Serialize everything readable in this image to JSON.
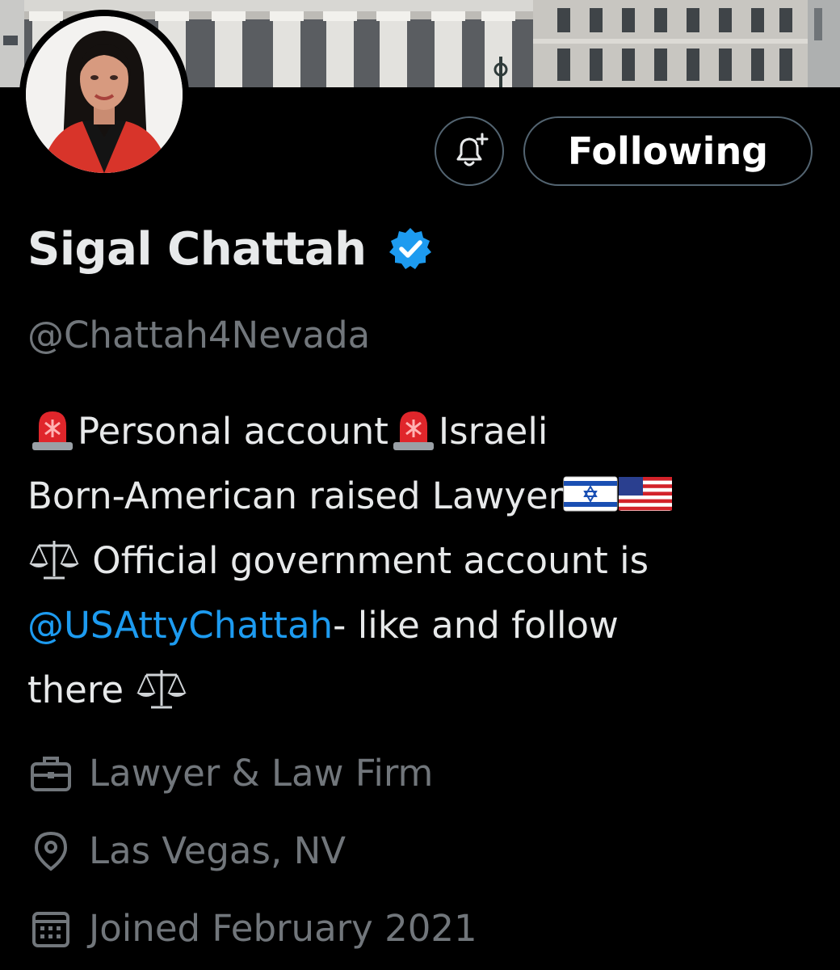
{
  "header": {
    "banner_image": "courthouse-columns-banner",
    "avatar_image": "profile-photo"
  },
  "actions": {
    "notify_icon": "bell-plus-icon",
    "follow_label": "Following"
  },
  "profile": {
    "display_name": "Sigal Chattah",
    "verified_icon": "verified-badge-icon",
    "handle": "@Chattah4Nevada"
  },
  "bio": {
    "line1_a": "Personal account",
    "line1_b": "Israeli",
    "line2": "Born-American raised Lawyer",
    "line3": " Official government account is",
    "line4_mention": "@USAttyChattah",
    "line4_rest": "- like and follow",
    "line5": "there "
  },
  "meta": {
    "category_icon": "briefcase-icon",
    "category": "Lawyer & Law Firm",
    "location_icon": "location-pin-icon",
    "location": "Las Vegas, NV",
    "joined_icon": "calendar-icon",
    "joined": "Joined February 2021"
  },
  "colors": {
    "background": "#000000",
    "primary_text": "#e7e9ea",
    "secondary_text": "#71767b",
    "link": "#1d9bf0",
    "verified": "#1d9bf0",
    "button_border": "#536471"
  }
}
